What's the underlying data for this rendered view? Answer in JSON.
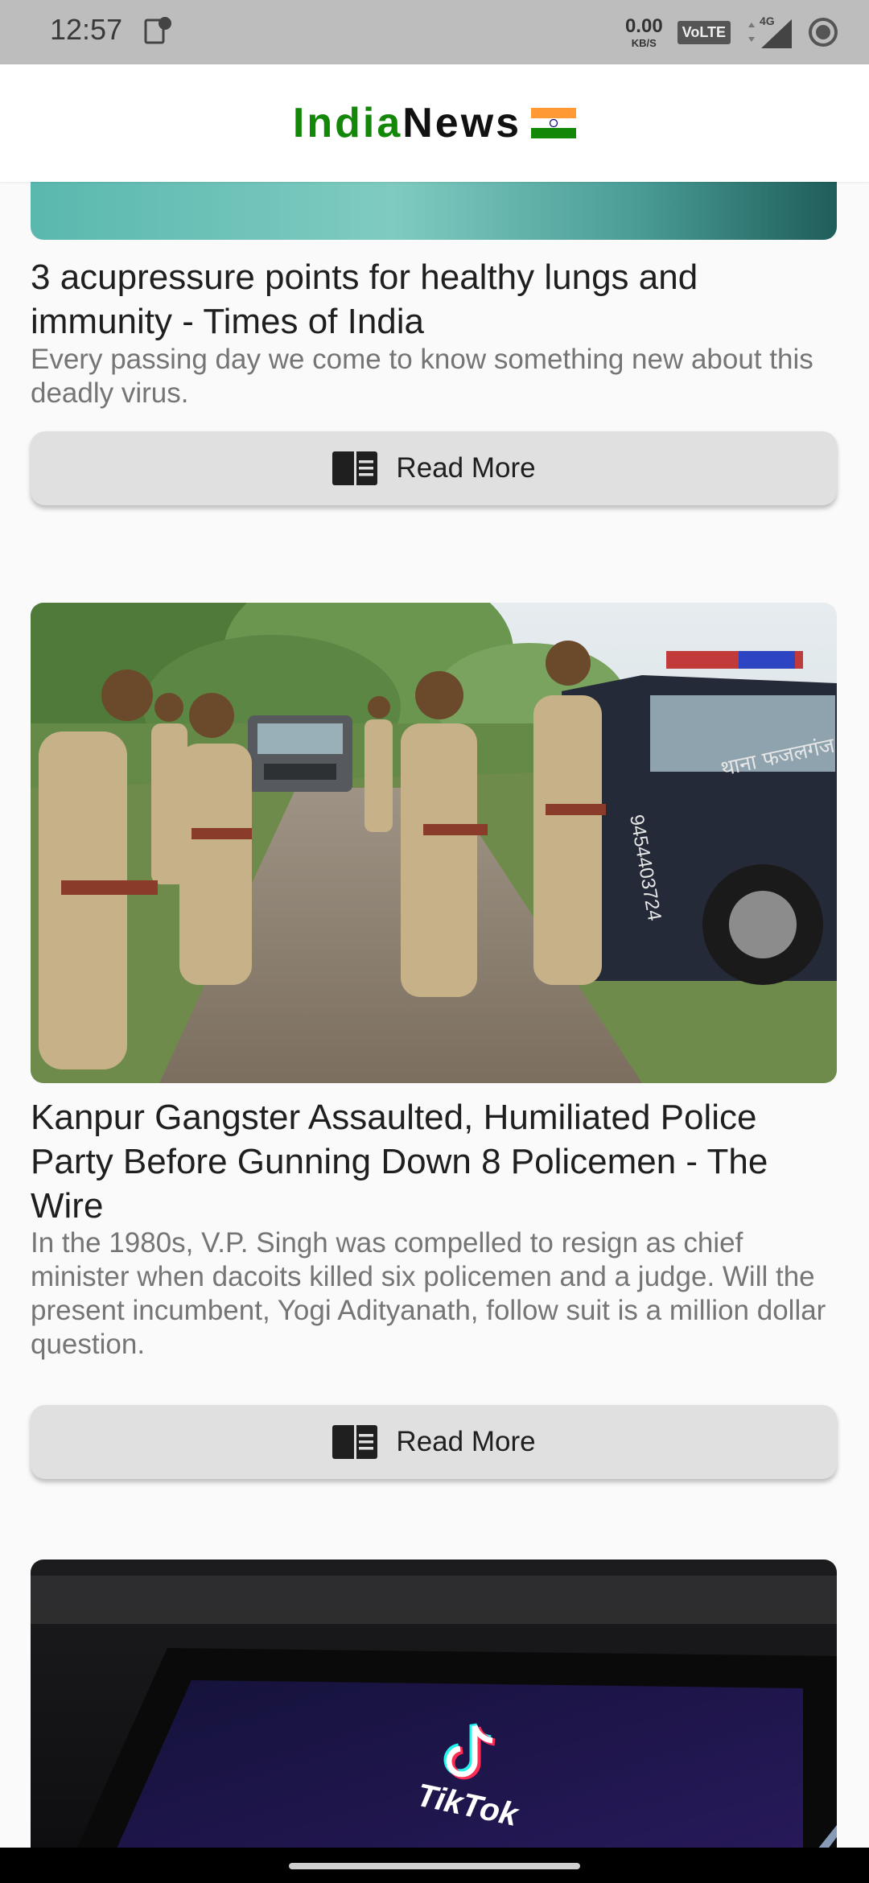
{
  "status_bar": {
    "time": "12:57",
    "net_speed_value": "0.00",
    "net_speed_unit": "KB/S",
    "volte": "VoLTE",
    "network": "4G"
  },
  "app_bar": {
    "title_part1": "India",
    "title_part2": "News"
  },
  "articles": [
    {
      "headline": "3 acupressure points for healthy lungs and immunity - Times of India",
      "description": "Every passing day we come to know something new about this deadly virus.",
      "read_more_label": "Read More"
    },
    {
      "headline": "Kanpur Gangster Assaulted, Humiliated Police Party Before Gunning Down 8 Policemen - The Wire",
      "description": "In the 1980s, V.P. Singh was compelled to resign as chief minister when dacoits killed six policemen and a judge. Will the present incumbent, Yogi Adityanath, follow suit is a million dollar question.",
      "read_more_label": "Read More",
      "image_signs": {
        "vehicle_number": "9454403724",
        "station_sign": "थाना फजलगंज"
      }
    },
    {
      "image_logo": "TikTok"
    }
  ],
  "colors": {
    "brand_green": "#138808",
    "status_bar": "#bdbdbd",
    "button_bg": "#e0e0e0"
  }
}
